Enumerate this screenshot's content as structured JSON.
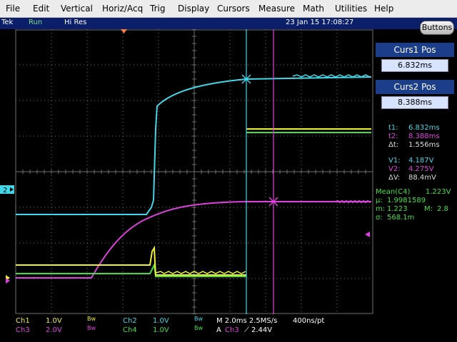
{
  "menu": [
    "File",
    "Edit",
    "Vertical",
    "Horiz/Acq",
    "Trig",
    "Display",
    "Cursors",
    "Measure",
    "Math",
    "Utilities",
    "Help"
  ],
  "status": {
    "brand": "Tek",
    "mode": "Run",
    "acq": "Hi Res",
    "datetime": "23 Jan 15 17:08:27"
  },
  "buttons_label": "Buttons",
  "channel_marker": "2",
  "cursor_panel": {
    "curs1_title": "Curs1 Pos",
    "curs1_value": "6.832ms",
    "curs2_title": "Curs2 Pos",
    "curs2_value": "8.388ms",
    "t1_label": "t1:",
    "t1_value": "6.832ms",
    "t2_label": "t2:",
    "t2_value": "8.388ms",
    "dt_label": "Δt:",
    "dt_value": "1.556ms",
    "v1_label": "V1:",
    "v1_value": "4.187V",
    "v2_label": "V2:",
    "v2_value": "4.275V",
    "dv_label": "ΔV:",
    "dv_value": "88.4mV"
  },
  "measure": {
    "mean_label": "Mean(C4)",
    "mean_value": "1.223V",
    "mu_label": "μ:",
    "mu_value": "1.9981589",
    "m_label": "m:",
    "m_value": "1.223",
    "M_label": "M:",
    "M_value": "2.8",
    "sigma_label": "σ:",
    "sigma_value": "568.1m"
  },
  "channels": {
    "ch1": {
      "label": "Ch1",
      "scale": "1.0V",
      "bw": "Bw"
    },
    "ch2": {
      "label": "Ch2",
      "scale": "1.0V",
      "bw": "Bw"
    },
    "ch3": {
      "label": "Ch3",
      "scale": "2.0V",
      "bw": "Bw"
    },
    "ch4": {
      "label": "Ch4",
      "scale": "1.0V",
      "bw": "Bw"
    }
  },
  "horizontal": {
    "timebase": "M 2.0ms 2.5MS/s",
    "resolution": "400ns/pt",
    "trigger_mode": "A",
    "trigger_source": "Ch3",
    "trigger_slope": "⟋",
    "trigger_level": "2.44V"
  },
  "colors": {
    "ch1": "#f0f030",
    "ch2": "#40d8e8",
    "ch3": "#e040e0",
    "ch4": "#40e040",
    "grid": "#707070"
  }
}
